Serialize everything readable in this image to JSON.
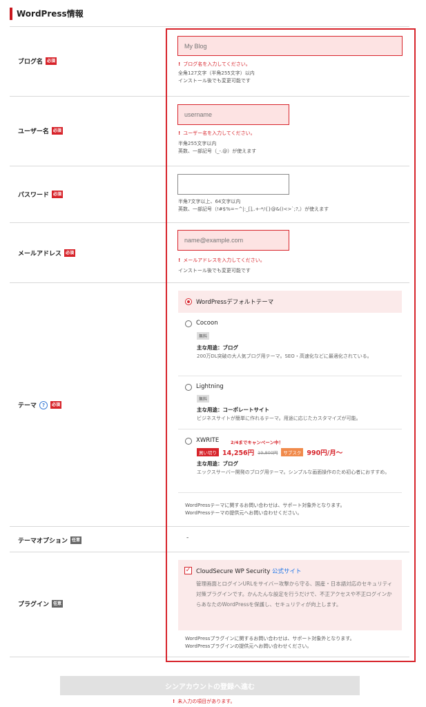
{
  "section_title": "WordPress情報",
  "badges": {
    "required": "必須",
    "optional": "任意"
  },
  "blog_name": {
    "label": "ブログ名",
    "placeholder": "My Blog",
    "error": "ブログ名を入力してください。",
    "note1": "全角127文字（半角255文字）以内",
    "note2": "インストール後でも変更可能です"
  },
  "username": {
    "label": "ユーザー名",
    "placeholder": "username",
    "error": "ユーザー名を入力してください。",
    "note1": "半角255文字以内",
    "note2": "英数、一部記号（_-.@）が使えます"
  },
  "password": {
    "label": "パスワード",
    "note1": "半角7文字以上、64文字以内",
    "note2": "英数、一部記号（!#$%=~^|:_[],.+-*/{}@&()<>`;?,）が使えます"
  },
  "email": {
    "label": "メールアドレス",
    "placeholder": "name@example.com",
    "error": "メールアドレスを入力してください。",
    "note": "インストール後でも変更可能です"
  },
  "theme": {
    "label": "テーマ",
    "help_icon": "?",
    "default_option": "WordPressデフォルトテーマ",
    "cocoon": {
      "name": "Cocoon",
      "badge": "無料",
      "use_label": "主な用途：ブログ",
      "desc": "200万DL突破の大人気ブログ用テーマ。SEO・高速化などに最適化されている。"
    },
    "lightning": {
      "name": "Lightning",
      "badge": "無料",
      "use_label": "主な用途：コーポレートサイト",
      "desc": "ビジネスサイトが簡単に作れるテーマ。用途に応じたカスタマイズが可能。"
    },
    "xwrite": {
      "name": "XWRITE",
      "campaign": "2/4までキャンペーン中！",
      "buyout_badge": "買い切り",
      "price": "14,256円",
      "old_price": "19,800円",
      "sub_badge": "サブスク",
      "sub_price": "990円/月〜",
      "use_label": "主な用途：ブログ",
      "desc": "エックスサーバー開発のブログ用テーマ。シンプルな画面操作のため初心者におすすめ。"
    },
    "footer1": "WordPressテーマに関するお問い合わせは、サポート対象外となります。",
    "footer2": "WordPressテーマの提供元へお問い合わせください。"
  },
  "theme_option": {
    "label": "テーマオプション",
    "value": "-"
  },
  "plugin": {
    "label": "プラグイン",
    "name": "CloudSecure WP Security",
    "link": "公式サイト",
    "desc": "管理画面とログインURLをサイバー攻撃から守る、国産・日本語対応のセキュリティ対策プラグインです。かんたんな設定を行うだけで、不正アクセスや不正ログインからあなたのWordPressを保護し、セキュリティが向上します。",
    "footer1": "WordPressプラグインに関するお問い合わせは、サポート対象外となります。",
    "footer2": "WordPressプラグインの提供元へお問い合わせください。"
  },
  "submit": {
    "label": "シンアカウントの登録へ進む",
    "error": "未入力の項目があります。"
  }
}
